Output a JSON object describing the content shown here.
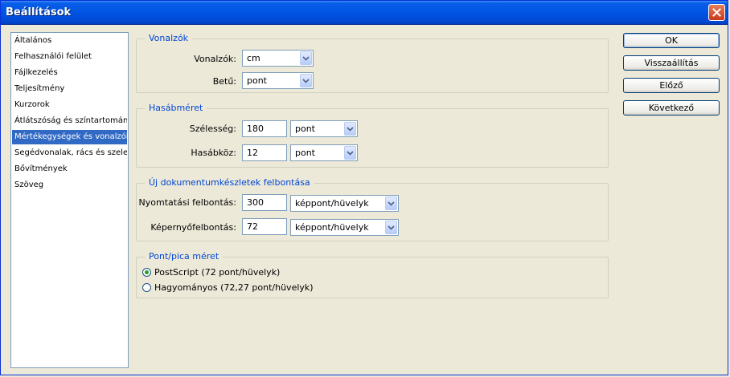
{
  "window": {
    "title": "Beállítások"
  },
  "categories": [
    "Általános",
    "Felhasználói felület",
    "Fájlkezelés",
    "Teljesítmény",
    "Kurzorok",
    "Átlátszóság és színtartomány",
    "Mértékegységek és vonalzók",
    "Segédvonalak, rács és szeletek",
    "Bővítmények",
    "Szöveg"
  ],
  "selected_category": "Mértékegységek és vonalzók",
  "units": {
    "legend": "Vonalzók",
    "rulers_label": "Vonalzók:",
    "rulers_value": "cm",
    "type_label": "Betű:",
    "type_value": "pont"
  },
  "column": {
    "legend": "Hasábméret",
    "width_label": "Szélesség:",
    "width_value": "180",
    "width_unit": "pont",
    "gutter_label": "Hasábköz:",
    "gutter_value": "12",
    "gutter_unit": "pont"
  },
  "resolution": {
    "legend": "Új dokumentumkészletek felbontása",
    "print_label": "Nyomtatási felbontás:",
    "print_value": "300",
    "print_unit": "képpont/hüvelyk",
    "screen_label": "Képernyőfelbontás:",
    "screen_value": "72",
    "screen_unit": "képpont/hüvelyk"
  },
  "point_size": {
    "legend": "Pont/pica méret",
    "postscript_label": "PostScript (72 pont/hüvelyk)",
    "traditional_label": "Hagyományos (72,27 pont/hüvelyk)",
    "selected": "postscript"
  },
  "buttons": {
    "ok": "OK",
    "reset": "Visszaállítás",
    "prev": "Előző",
    "next": "Következő"
  },
  "colors": {
    "selection": "#316ac5",
    "legend_text": "#0046d5",
    "dialog_bg": "#ece9d8"
  }
}
